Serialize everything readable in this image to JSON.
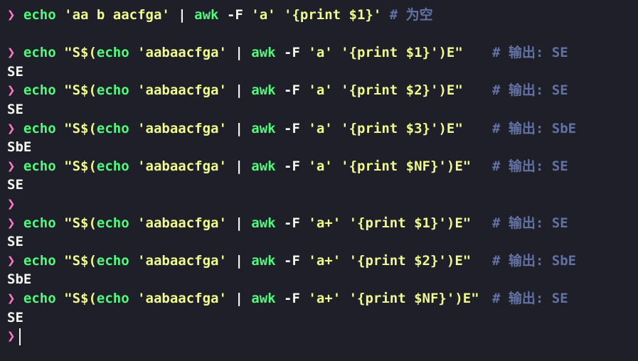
{
  "terminal": {
    "prompt_symbol": "❯",
    "lines": [
      {
        "type": "cmd",
        "parts": [
          {
            "cls": "cmd",
            "text": "echo"
          },
          {
            "cls": "op",
            "text": " "
          },
          {
            "cls": "str",
            "text": "'aa b aacfga'"
          },
          {
            "cls": "op",
            "text": " | "
          },
          {
            "cls": "cmd",
            "text": "awk"
          },
          {
            "cls": "flag",
            "text": " -F "
          },
          {
            "cls": "str",
            "text": "'a'"
          },
          {
            "cls": "op",
            "text": " "
          },
          {
            "cls": "str",
            "text": "'{print $1}'"
          }
        ],
        "comment": "# 为空",
        "comment_inline": true
      },
      {
        "type": "blank"
      },
      {
        "type": "cmd",
        "parts": [
          {
            "cls": "cmd",
            "text": "echo"
          },
          {
            "cls": "op",
            "text": " "
          },
          {
            "cls": "str",
            "text": "\"S$("
          },
          {
            "cls": "cmd",
            "text": "echo"
          },
          {
            "cls": "op",
            "text": " "
          },
          {
            "cls": "str",
            "text": "'aabaacfga'"
          },
          {
            "cls": "op",
            "text": " | "
          },
          {
            "cls": "cmd",
            "text": "awk"
          },
          {
            "cls": "flag",
            "text": " -F "
          },
          {
            "cls": "str",
            "text": "'a'"
          },
          {
            "cls": "op",
            "text": " "
          },
          {
            "cls": "str",
            "text": "'{print $1}'"
          },
          {
            "cls": "str",
            "text": ")E\""
          }
        ],
        "comment": "# 输出: SE"
      },
      {
        "type": "out",
        "text": "SE"
      },
      {
        "type": "cmd",
        "parts": [
          {
            "cls": "cmd",
            "text": "echo"
          },
          {
            "cls": "op",
            "text": " "
          },
          {
            "cls": "str",
            "text": "\"S$("
          },
          {
            "cls": "cmd",
            "text": "echo"
          },
          {
            "cls": "op",
            "text": " "
          },
          {
            "cls": "str",
            "text": "'aabaacfga'"
          },
          {
            "cls": "op",
            "text": " | "
          },
          {
            "cls": "cmd",
            "text": "awk"
          },
          {
            "cls": "flag",
            "text": " -F "
          },
          {
            "cls": "str",
            "text": "'a'"
          },
          {
            "cls": "op",
            "text": " "
          },
          {
            "cls": "str",
            "text": "'{print $2}'"
          },
          {
            "cls": "str",
            "text": ")E\""
          }
        ],
        "comment": "# 输出: SE"
      },
      {
        "type": "out",
        "text": "SE"
      },
      {
        "type": "cmd",
        "parts": [
          {
            "cls": "cmd",
            "text": "echo"
          },
          {
            "cls": "op",
            "text": " "
          },
          {
            "cls": "str",
            "text": "\"S$("
          },
          {
            "cls": "cmd",
            "text": "echo"
          },
          {
            "cls": "op",
            "text": " "
          },
          {
            "cls": "str",
            "text": "'aabaacfga'"
          },
          {
            "cls": "op",
            "text": " | "
          },
          {
            "cls": "cmd",
            "text": "awk"
          },
          {
            "cls": "flag",
            "text": " -F "
          },
          {
            "cls": "str",
            "text": "'a'"
          },
          {
            "cls": "op",
            "text": " "
          },
          {
            "cls": "str",
            "text": "'{print $3}'"
          },
          {
            "cls": "str",
            "text": ")E\""
          }
        ],
        "comment": "# 输出: SbE"
      },
      {
        "type": "out",
        "text": "SbE"
      },
      {
        "type": "cmd",
        "parts": [
          {
            "cls": "cmd",
            "text": "echo"
          },
          {
            "cls": "op",
            "text": " "
          },
          {
            "cls": "str",
            "text": "\"S$("
          },
          {
            "cls": "cmd",
            "text": "echo"
          },
          {
            "cls": "op",
            "text": " "
          },
          {
            "cls": "str",
            "text": "'aabaacfga'"
          },
          {
            "cls": "op",
            "text": " | "
          },
          {
            "cls": "cmd",
            "text": "awk"
          },
          {
            "cls": "flag",
            "text": " -F "
          },
          {
            "cls": "str",
            "text": "'a'"
          },
          {
            "cls": "op",
            "text": " "
          },
          {
            "cls": "str",
            "text": "'{print $NF}'"
          },
          {
            "cls": "str",
            "text": ")E\""
          }
        ],
        "comment": "# 输出: SE"
      },
      {
        "type": "out",
        "text": "SE"
      },
      {
        "type": "prompt_only"
      },
      {
        "type": "cmd",
        "parts": [
          {
            "cls": "cmd",
            "text": "echo"
          },
          {
            "cls": "op",
            "text": " "
          },
          {
            "cls": "str",
            "text": "\"S$("
          },
          {
            "cls": "cmd",
            "text": "echo"
          },
          {
            "cls": "op",
            "text": " "
          },
          {
            "cls": "str",
            "text": "'aabaacfga'"
          },
          {
            "cls": "op",
            "text": " | "
          },
          {
            "cls": "cmd",
            "text": "awk"
          },
          {
            "cls": "flag",
            "text": " -F "
          },
          {
            "cls": "str",
            "text": "'a+'"
          },
          {
            "cls": "op",
            "text": " "
          },
          {
            "cls": "str",
            "text": "'{print $1}'"
          },
          {
            "cls": "str",
            "text": ")E\""
          }
        ],
        "comment": "# 输出: SE"
      },
      {
        "type": "out",
        "text": "SE"
      },
      {
        "type": "cmd",
        "parts": [
          {
            "cls": "cmd",
            "text": "echo"
          },
          {
            "cls": "op",
            "text": " "
          },
          {
            "cls": "str",
            "text": "\"S$("
          },
          {
            "cls": "cmd",
            "text": "echo"
          },
          {
            "cls": "op",
            "text": " "
          },
          {
            "cls": "str",
            "text": "'aabaacfga'"
          },
          {
            "cls": "op",
            "text": " | "
          },
          {
            "cls": "cmd",
            "text": "awk"
          },
          {
            "cls": "flag",
            "text": " -F "
          },
          {
            "cls": "str",
            "text": "'a+'"
          },
          {
            "cls": "op",
            "text": " "
          },
          {
            "cls": "str",
            "text": "'{print $2}'"
          },
          {
            "cls": "str",
            "text": ")E\""
          }
        ],
        "comment": "# 输出: SbE"
      },
      {
        "type": "out",
        "text": "SbE"
      },
      {
        "type": "cmd",
        "parts": [
          {
            "cls": "cmd",
            "text": "echo"
          },
          {
            "cls": "op",
            "text": " "
          },
          {
            "cls": "str",
            "text": "\"S$("
          },
          {
            "cls": "cmd",
            "text": "echo"
          },
          {
            "cls": "op",
            "text": " "
          },
          {
            "cls": "str",
            "text": "'aabaacfga'"
          },
          {
            "cls": "op",
            "text": " | "
          },
          {
            "cls": "cmd",
            "text": "awk"
          },
          {
            "cls": "flag",
            "text": " -F "
          },
          {
            "cls": "str",
            "text": "'a+'"
          },
          {
            "cls": "op",
            "text": " "
          },
          {
            "cls": "str",
            "text": "'{print $NF}'"
          },
          {
            "cls": "str",
            "text": ")E\""
          }
        ],
        "comment": "# 输出: SE"
      },
      {
        "type": "out",
        "text": "SE"
      },
      {
        "type": "prompt_cursor"
      }
    ]
  },
  "colors": {
    "background": "#1e1f29",
    "prompt": "#ff79c6",
    "command": "#50fa7b",
    "string": "#f1fa8c",
    "comment": "#6272a4",
    "text": "#f8f8f2"
  }
}
